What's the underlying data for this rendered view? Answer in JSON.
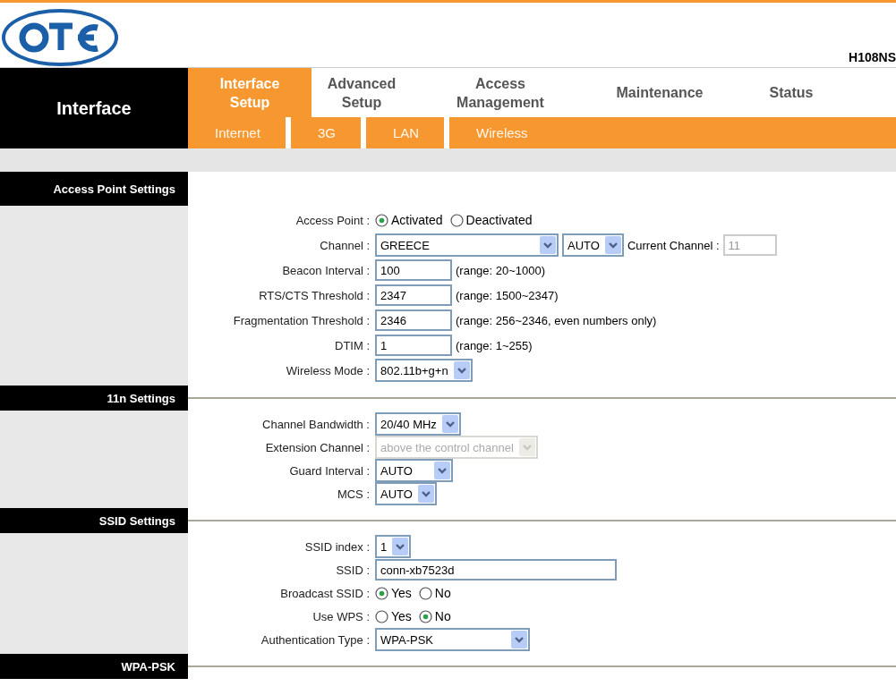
{
  "header": {
    "model": "H108NS"
  },
  "nav": {
    "section_title": "Interface",
    "tabs": [
      {
        "label": "Interface\nSetup",
        "selected": true
      },
      {
        "label": "Advanced\nSetup",
        "selected": false
      },
      {
        "label": "Access\nManagement",
        "selected": false
      },
      {
        "label": "Maintenance",
        "selected": false
      },
      {
        "label": "Status",
        "selected": false
      }
    ],
    "subtabs": [
      {
        "label": "Internet"
      },
      {
        "label": "3G"
      },
      {
        "label": "LAN"
      },
      {
        "label": "Wireless"
      }
    ]
  },
  "sections": [
    {
      "title": "Access Point Settings",
      "rows": [
        {
          "label": "Access Point :",
          "controls": [
            {
              "kind": "radio",
              "label": "Activated",
              "selected": true
            },
            {
              "kind": "radio",
              "label": "Deactivated",
              "selected": false
            }
          ]
        },
        {
          "label": "Channel :",
          "controls": [
            {
              "kind": "wide_select",
              "value": "GREECE",
              "disabled": false
            },
            {
              "kind": "select",
              "value": "AUTO",
              "disabled": false
            },
            {
              "kind": "label",
              "text": "Current Channel :"
            },
            {
              "kind": "input",
              "value": "11",
              "disabled": true
            }
          ]
        },
        {
          "label": "Beacon Interval :",
          "controls": [
            {
              "kind": "input",
              "value": "100",
              "disabled": false
            },
            {
              "kind": "note",
              "text": "(range: 20~1000)"
            }
          ]
        },
        {
          "label": "RTS/CTS Threshold :",
          "controls": [
            {
              "kind": "input",
              "value": "2347",
              "disabled": false
            },
            {
              "kind": "note",
              "text": "(range: 1500~2347)"
            }
          ]
        },
        {
          "label": "Fragmentation Threshold :",
          "controls": [
            {
              "kind": "input",
              "value": "2346",
              "disabled": false
            },
            {
              "kind": "note",
              "text": "(range: 256~2346, even numbers only)"
            }
          ]
        },
        {
          "label": "DTIM :",
          "controls": [
            {
              "kind": "input",
              "value": "1",
              "disabled": false
            },
            {
              "kind": "note",
              "text": "(range: 1~255)"
            }
          ]
        },
        {
          "label": "Wireless Mode :",
          "controls": [
            {
              "kind": "select",
              "value": "802.11b+g+n",
              "disabled": false
            }
          ]
        }
      ]
    },
    {
      "title": "11n Settings",
      "rows": [
        {
          "label": "Channel Bandwidth :",
          "controls": [
            {
              "kind": "select",
              "value": "20/40 MHz",
              "disabled": false
            }
          ]
        },
        {
          "label": "Extension Channel :",
          "controls": [
            {
              "kind": "select",
              "value": "above the control channel",
              "disabled": true
            }
          ]
        },
        {
          "label": "Guard Interval :",
          "controls": [
            {
              "kind": "select",
              "value": "AUTO     ",
              "disabled": false
            }
          ]
        },
        {
          "label": "MCS :",
          "controls": [
            {
              "kind": "select",
              "value": "AUTO",
              "disabled": false
            }
          ]
        }
      ]
    },
    {
      "title": "SSID Settings",
      "rows": [
        {
          "label": "SSID index :",
          "controls": [
            {
              "kind": "select",
              "value": "1",
              "disabled": false
            }
          ]
        },
        {
          "label": "SSID :",
          "controls": [
            {
              "kind": "long_input",
              "value": "conn-xb7523d",
              "disabled": false
            }
          ]
        },
        {
          "label": "Broadcast SSID :",
          "controls": [
            {
              "kind": "radio",
              "label": "Yes",
              "selected": true
            },
            {
              "kind": "radio",
              "label": "No",
              "selected": false
            }
          ]
        },
        {
          "label": "Use WPS :",
          "controls": [
            {
              "kind": "radio",
              "label": "Yes",
              "selected": false
            },
            {
              "kind": "radio",
              "label": "No",
              "selected": true
            }
          ]
        },
        {
          "label": "Authentication Type :",
          "controls": [
            {
              "kind": "wide_select",
              "value": "WPA-PSK",
              "disabled": false
            }
          ]
        }
      ]
    },
    {
      "title": "WPA-PSK"
    }
  ]
}
